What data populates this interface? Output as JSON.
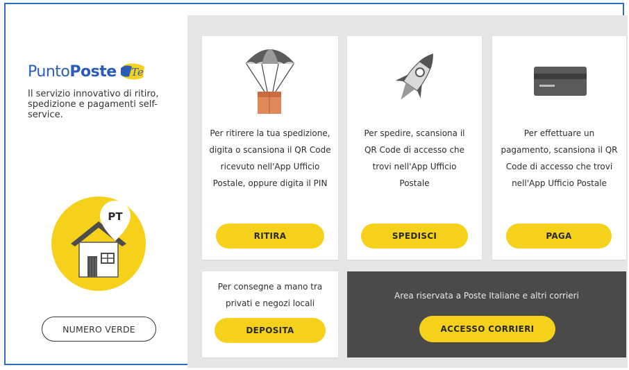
{
  "brand": {
    "punto": "Punto",
    "poste": "Poste",
    "badge": "Te"
  },
  "tagline": "Il servizio innovativo di ritiro, spedizione e pagamenti self-service.",
  "house": {
    "pin_label": "PT"
  },
  "numero_verde": {
    "label": "NUMERO VERDE"
  },
  "cards": {
    "ritira": {
      "icon": "parachute-package-icon",
      "text": "Per ritirere la tua spedizione, digita o scansiona il QR Code ricevuto nell'App Ufficio Postale, oppure digita il PIN",
      "button": "RITIRA"
    },
    "spedisci": {
      "icon": "rocket-icon",
      "text": "Per spedire, scansiona il QR Code di accesso che trovi nell'App Ufficio Postale",
      "button": "SPEDISCI"
    },
    "paga": {
      "icon": "credit-card-icon",
      "text": "Per effettuare un pagamento, scansiona il QR Code di accesso che trovi nell'App Ufficio Postale",
      "button": "PAGA"
    },
    "deposita": {
      "text": "Per consegne a mano tra privati e negozi locali",
      "button": "DEPOSITA"
    },
    "corrieri": {
      "text": "Area riservata a Poste Italiane e altri corrieri",
      "button": "ACCESSO CORRIERI"
    }
  },
  "colors": {
    "brand_blue": "#2a5db8",
    "accent_yellow": "#f6d11b",
    "panel_gray": "#e6e6e6",
    "dark_card": "#4a4a4a",
    "frame_blue": "#2a6cc4"
  }
}
